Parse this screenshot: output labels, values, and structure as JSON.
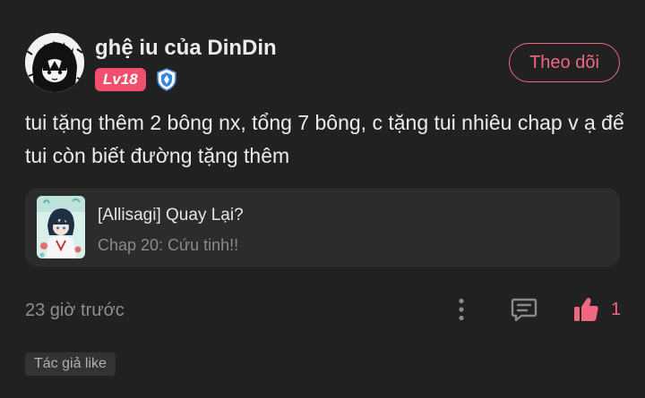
{
  "user": {
    "name": "ghệ iu của DinDin",
    "level": "Lv18",
    "follow_label": "Theo dõi"
  },
  "comment": {
    "text": "tui tặng thêm 2 bông nx, tổng 7 bông, c tặng tui nhiêu chap v ạ để tui còn biết đường tặng thêm"
  },
  "manga": {
    "title": "[Allisagi] Quay Lại?",
    "chapter": "Chap 20: Cứu tinh!!"
  },
  "footer": {
    "timestamp": "23 giờ trước",
    "like_count": "1",
    "author_like": "Tác giả like"
  },
  "icons": {
    "more": "more-vertical-icon",
    "reply": "comment-icon",
    "like": "thumbs-up-icon",
    "shield": "shield-badge-icon"
  },
  "colors": {
    "accent": "#f0677f",
    "level_badge": "#f0506e",
    "shield_blue": "#3a86d8"
  }
}
